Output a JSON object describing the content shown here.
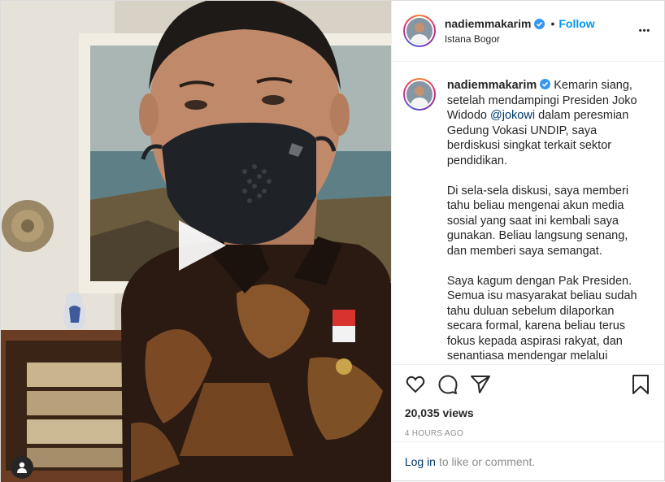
{
  "post": {
    "username": "nadiemmakarim",
    "follow_label": "Follow",
    "dot": "•",
    "location": "Istana Bogor",
    "more_label": "•••",
    "caption": {
      "username": "nadiemmakarim",
      "p1_before": "Kemarin siang, setelah mendampingi Presiden Joko Widodo ",
      "mention": "@jokowi",
      "p1_after": " dalam peresmian Gedung Vokasi UNDIP, saya berdiskusi singkat terkait sektor pendidikan.",
      "p2": "Di sela-sela diskusi, saya memberi tahu beliau mengenai akun media sosial yang saat ini kembali saya gunakan. Beliau langsung senang, dan memberi saya semangat.",
      "p3": "Saya kagum dengan Pak Presiden. Semua isu masyarakat beliau sudah tahu duluan sebelum dilaporkan secara formal, karena beliau terus fokus kepada aspirasi rakyat, dan senantiasa mendengar melalui"
    },
    "views": "20,035 views",
    "timestamp": "4 HOURS AGO",
    "login_link": "Log in",
    "login_rest": "to like or comment."
  },
  "icons": {
    "verified": "verified-badge-icon",
    "like": "heart-icon",
    "comment": "comment-icon",
    "share": "paper-plane-icon",
    "save": "bookmark-icon",
    "play": "play-icon",
    "tagged": "user-tag-icon"
  },
  "colors": {
    "accent": "#0095f6",
    "mention": "#00376b",
    "muted": "#8e8e8e",
    "text": "#262626"
  }
}
